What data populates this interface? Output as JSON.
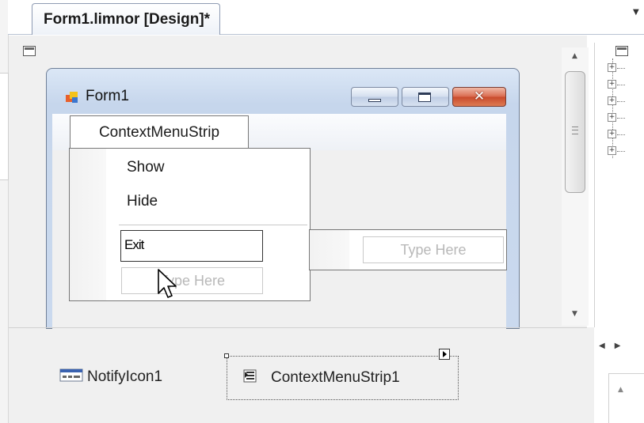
{
  "document_tab": {
    "title": "Form1.limnor [Design]*"
  },
  "form": {
    "title": "Form1",
    "context_menu": {
      "header": "ContextMenuStrip",
      "items": [
        "Show",
        "Hide"
      ],
      "editing_value": "Exit",
      "type_here_placeholder": "Type Here",
      "submenu_placeholder": "Type Here"
    }
  },
  "component_tray": {
    "notify_icon": {
      "label": "NotifyIcon1"
    },
    "context_menu_strip": {
      "label": "ContextMenuStrip1"
    }
  },
  "icons": {
    "form": "form-icon",
    "minimize": "minimize-icon",
    "maximize": "maximize-icon",
    "close": "close-icon",
    "notify": "notify-icon",
    "context_menu_strip": "context-menu-strip-icon",
    "smart_tag": "smart-tag-arrow-icon",
    "cursor": "mouse-pointer-icon",
    "tree_expand": "plus-icon"
  },
  "colors": {
    "window_frame": "#c6d6ec",
    "close_button": "#c84a2c",
    "placeholder_text": "#b8b8b8"
  }
}
